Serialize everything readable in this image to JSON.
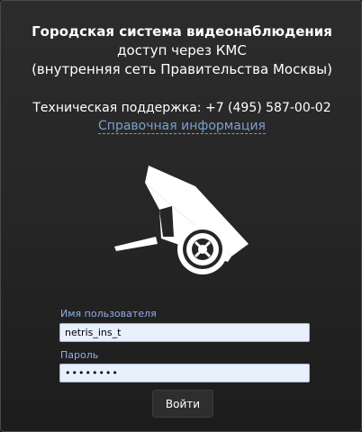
{
  "header": {
    "title": "Городская система видеонаблюдения",
    "subtitle": "доступ через КМС",
    "network": "(внутренняя сеть Правительства Москвы)"
  },
  "support": {
    "text": "Техническая поддержка: +7 (495) 587-00-02",
    "help_link": "Справочная информация"
  },
  "logo": {
    "icon": "cctv-camera-icon"
  },
  "form": {
    "username_label": "Имя пользователя",
    "username_value": "netris_ins_t",
    "password_label": "Пароль",
    "password_value": "••••••••",
    "submit_label": "Войти"
  },
  "colors": {
    "background": "#1a1a1a",
    "link": "#7a9fcf",
    "field_label": "#8fb0e3",
    "field_background": "#e8f0fe"
  }
}
